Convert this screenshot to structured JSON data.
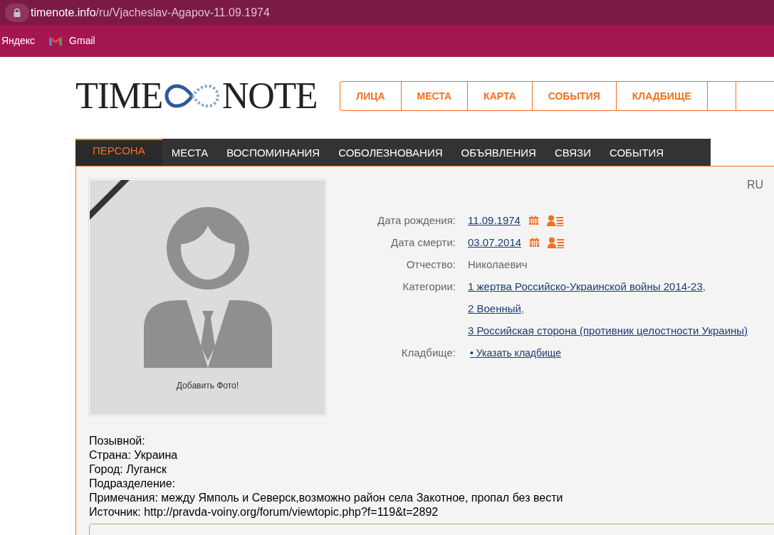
{
  "browser": {
    "url_host": "timenote.info",
    "url_path": "/ru/Vjacheslav-Agapov-11.09.1974",
    "bookmarks": [
      {
        "label": "Яндекс",
        "kind": "plain"
      },
      {
        "label": "Gmail",
        "kind": "gmail"
      }
    ]
  },
  "logo": {
    "left": "TIME",
    "right": "NOTE"
  },
  "top_nav": [
    "ЛИЦА",
    "МЕСТА",
    "КАРТА",
    "СОБЫТИЯ",
    "КЛАДБИЩЕ"
  ],
  "tabs": [
    {
      "label": "ПЕРСОНА",
      "selected": true
    },
    {
      "label": "МЕСТА",
      "selected": false
    },
    {
      "label": "ВОСПОМИНАНИЯ",
      "selected": false
    },
    {
      "label": "СОБОЛЕЗНОВАНИЯ",
      "selected": false
    },
    {
      "label": "ОБЪЯВЛЕНИЯ",
      "selected": false
    },
    {
      "label": "СВЯЗИ",
      "selected": false
    },
    {
      "label": "СОБЫТИЯ",
      "selected": false
    }
  ],
  "language": "RU",
  "photo": {
    "caption": "Добавить Фото!",
    "mourning_ribbon": true
  },
  "fields": [
    {
      "label": "Дата рождения:",
      "kind": "date",
      "value": "11.09.1974"
    },
    {
      "label": "Дата смерти:",
      "kind": "date",
      "value": "03.07.2014"
    },
    {
      "label": "Отчество:",
      "kind": "text",
      "value": "Николаевич"
    },
    {
      "label": "Категории:",
      "kind": "links",
      "separator": ",",
      "links": [
        "1 жертва Российско-Украинской войны 2014-23",
        "2 Военный",
        "3 Российская сторона (противник целостности Украины)"
      ]
    },
    {
      "label": "Кладбище:",
      "kind": "link",
      "value": "• Указать кладбище"
    }
  ],
  "notes": [
    "Позывной:",
    "Страна: Украина",
    "Город: Луганск",
    "Подразделение:",
    "Примечания: между Ямполь и Северск,возможно район села Закотное, пропал без вести",
    "Источник: http://pravda-voiny.org/forum/viewtopic.php?f=119&t=2892"
  ]
}
